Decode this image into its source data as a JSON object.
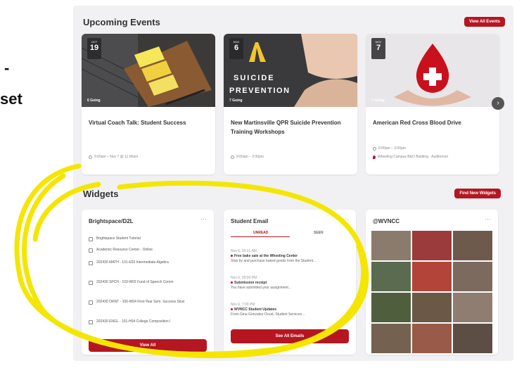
{
  "edge": {
    "dash": "-",
    "set": "set"
  },
  "events": {
    "title": "Upcoming Events",
    "view_all": "View All Events",
    "cards": [
      {
        "month": "OCT",
        "day": "19",
        "going": "6 Going",
        "title": "Virtual Coach Talk: Student Success",
        "time": "9:00am – Nov 7 @ 11:00am",
        "location": ""
      },
      {
        "month": "NOV",
        "day": "6",
        "going": "7 Going",
        "title": "New Martinsville QPR Suicide Prevention Training Workshops",
        "time": "9:00am – 2:00pm",
        "location": "",
        "image_text": [
          "SUICIDE",
          "PREVENTION"
        ]
      },
      {
        "month": "NOV",
        "day": "7",
        "going": "7 Going",
        "title": "American Red Cross Blood Drive",
        "time": "9:00am – 3:00pm",
        "location": "Wheeling Campus B&O Building · Auditorium"
      }
    ]
  },
  "widgets": {
    "title": "Widgets",
    "find_new": "Find New Widgets",
    "brightspace": {
      "title": "Brightspace/D2L",
      "items": [
        "Brightspace Student Tutorial",
        "Academic Resource Center - Online",
        "202430 MATH - 101-E03 Intermediate Algebra",
        "202430 SPCH - 103-W02 Fund of Speech Comm",
        "202430 ORNT - 100-W04 First-Year Sem: Success Strat",
        "202430 ENGL - 101-H04 College Composition I"
      ],
      "button": "View All"
    },
    "email": {
      "title": "Student Email",
      "tabs": [
        "UNREAD",
        "SEEN"
      ],
      "items": [
        {
          "date": "Nov 6, 10:31 AM",
          "sender": "Free bake sale at the Wheeling Center",
          "preview": "Stop by and purchase baked goods from the Student..."
        },
        {
          "date": "Nov 6, 09:00 PM",
          "sender": "Submission receipt",
          "preview": "You have submitted your assignment..."
        },
        {
          "date": "Nov 6, 7:00 PM",
          "sender": "WVNCC Student Updates",
          "preview": "From Gina Gonzales Cloud, Student Services..."
        }
      ],
      "button": "See All Emails"
    },
    "social": {
      "title": "@WVNCC",
      "photo_colors": [
        "#8a7b6c",
        "#9c3b3b",
        "#6e5a4d",
        "#5a6b4f",
        "#b2443a",
        "#7d6a5e",
        "#4f5f3d",
        "#6b5847",
        "#8e7d70",
        "#74614f",
        "#9a5a4a",
        "#5c4d45"
      ]
    }
  },
  "colors": {
    "accent": "#b51621",
    "highlight": "#f4e600"
  }
}
